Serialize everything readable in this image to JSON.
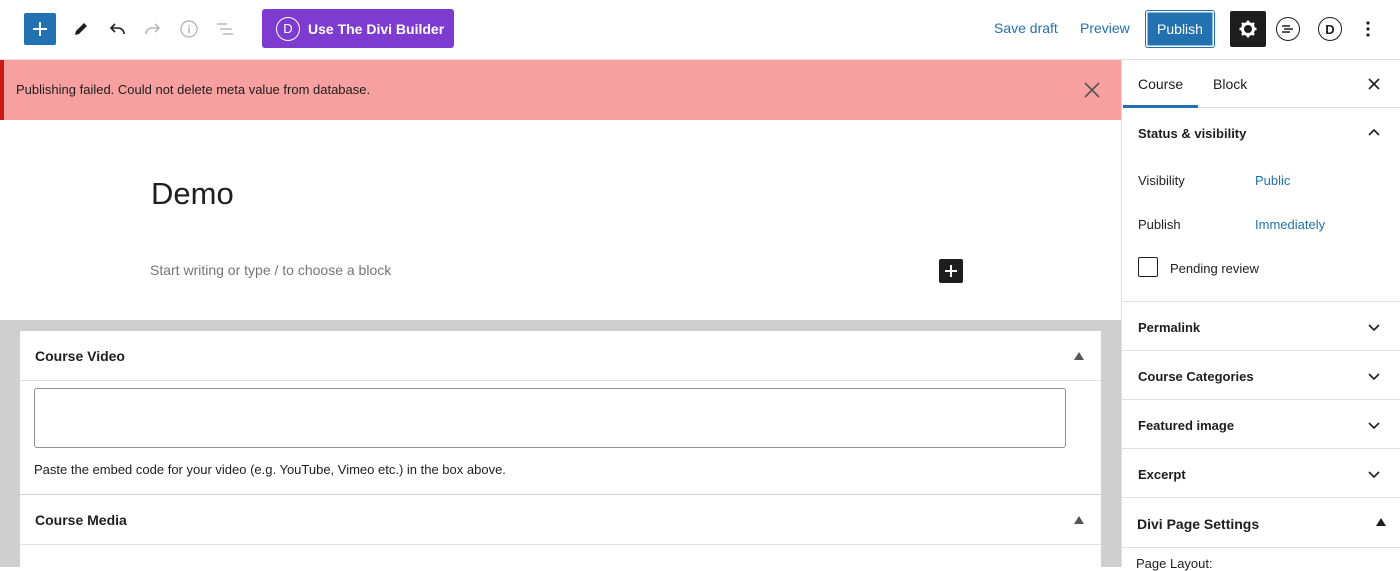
{
  "toolbar": {
    "add_block_icon": "plus-icon",
    "tools_icon": "pencil-icon",
    "undo_icon": "undo-icon",
    "redo_icon": "redo-icon",
    "details_icon": "info-icon",
    "list_view_icon": "list-view-icon",
    "divi_button_label": "Use The Divi Builder",
    "divi_logo_letter": "D",
    "save_draft_label": "Save draft",
    "preview_label": "Preview",
    "publish_label": "Publish",
    "settings_icon": "gear-icon",
    "performance_icon": "performance-icon",
    "divi_icon_letter": "D",
    "more_icon": "vertical-ellipsis-icon"
  },
  "notice": {
    "message": "Publishing failed. Could not delete meta value from database.",
    "close_icon": "close-icon"
  },
  "editor": {
    "post_title": "Demo",
    "block_placeholder": "Start writing or type / to choose a block",
    "inline_add_icon": "plus-icon"
  },
  "metaboxes": [
    {
      "title": "Course Video",
      "description": "Paste the embed code for your video (e.g. YouTube, Vimeo etc.) in the box above."
    },
    {
      "title": "Course Media"
    }
  ],
  "sidebar": {
    "tabs": [
      {
        "label": "Course",
        "active": true
      },
      {
        "label": "Block",
        "active": false
      }
    ],
    "status_visibility": {
      "title": "Status & visibility",
      "visibility_label": "Visibility",
      "visibility_value": "Public",
      "publish_label": "Publish",
      "publish_value": "Immediately",
      "pending_review_label": "Pending review",
      "pending_review_checked": false
    },
    "panels": [
      {
        "title": "Permalink"
      },
      {
        "title": "Course Categories"
      },
      {
        "title": "Featured image"
      },
      {
        "title": "Excerpt"
      }
    ],
    "divi_settings": {
      "title": "Divi Page Settings",
      "page_layout_label": "Page Layout:"
    }
  },
  "colors": {
    "accent": "#2271b1",
    "divi_purple": "#7e3bd0",
    "notice_background": "#f8a0a0",
    "notice_border": "#cc1818"
  }
}
